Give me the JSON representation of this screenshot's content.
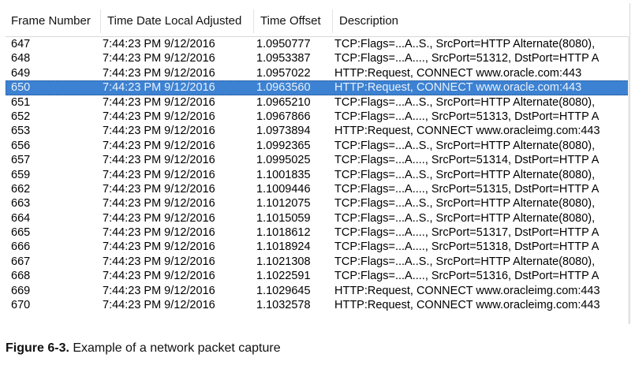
{
  "table": {
    "columns": {
      "frame": "Frame Number",
      "time": "Time Date Local Adjusted",
      "offset": "Time Offset",
      "description": "Description"
    },
    "selected_index": 3,
    "rows": [
      {
        "frame": "647",
        "time": "7:44:23 PM 9/12/2016",
        "offset": "1.0950777",
        "description": "TCP:Flags=...A..S., SrcPort=HTTP Alternate(8080),"
      },
      {
        "frame": "648",
        "time": "7:44:23 PM 9/12/2016",
        "offset": "1.0953387",
        "description": "TCP:Flags=...A...., SrcPort=51312, DstPort=HTTP A"
      },
      {
        "frame": "649",
        "time": "7:44:23 PM 9/12/2016",
        "offset": "1.0957022",
        "description": "HTTP:Request, CONNECT www.oracle.com:443"
      },
      {
        "frame": "650",
        "time": "7:44:23 PM 9/12/2016",
        "offset": "1.0963560",
        "description": "HTTP:Request, CONNECT www.oracle.com:443"
      },
      {
        "frame": "651",
        "time": "7:44:23 PM 9/12/2016",
        "offset": "1.0965210",
        "description": "TCP:Flags=...A..S., SrcPort=HTTP Alternate(8080),"
      },
      {
        "frame": "652",
        "time": "7:44:23 PM 9/12/2016",
        "offset": "1.0967866",
        "description": "TCP:Flags=...A...., SrcPort=51313, DstPort=HTTP A"
      },
      {
        "frame": "653",
        "time": "7:44:23 PM 9/12/2016",
        "offset": "1.0973894",
        "description": "HTTP:Request, CONNECT www.oracleimg.com:443"
      },
      {
        "frame": "656",
        "time": "7:44:23 PM 9/12/2016",
        "offset": "1.0992365",
        "description": "TCP:Flags=...A..S., SrcPort=HTTP Alternate(8080),"
      },
      {
        "frame": "657",
        "time": "7:44:23 PM 9/12/2016",
        "offset": "1.0995025",
        "description": "TCP:Flags=...A...., SrcPort=51314, DstPort=HTTP A"
      },
      {
        "frame": "659",
        "time": "7:44:23 PM 9/12/2016",
        "offset": "1.1001835",
        "description": "TCP:Flags=...A..S., SrcPort=HTTP Alternate(8080),"
      },
      {
        "frame": "662",
        "time": "7:44:23 PM 9/12/2016",
        "offset": "1.1009446",
        "description": "TCP:Flags=...A...., SrcPort=51315, DstPort=HTTP A"
      },
      {
        "frame": "663",
        "time": "7:44:23 PM 9/12/2016",
        "offset": "1.1012075",
        "description": "TCP:Flags=...A..S., SrcPort=HTTP Alternate(8080),"
      },
      {
        "frame": "664",
        "time": "7:44:23 PM 9/12/2016",
        "offset": "1.1015059",
        "description": "TCP:Flags=...A..S., SrcPort=HTTP Alternate(8080),"
      },
      {
        "frame": "665",
        "time": "7:44:23 PM 9/12/2016",
        "offset": "1.1018612",
        "description": "TCP:Flags=...A...., SrcPort=51317, DstPort=HTTP A"
      },
      {
        "frame": "666",
        "time": "7:44:23 PM 9/12/2016",
        "offset": "1.1018924",
        "description": "TCP:Flags=...A...., SrcPort=51318, DstPort=HTTP A"
      },
      {
        "frame": "667",
        "time": "7:44:23 PM 9/12/2016",
        "offset": "1.1021308",
        "description": "TCP:Flags=...A..S., SrcPort=HTTP Alternate(8080),"
      },
      {
        "frame": "668",
        "time": "7:44:23 PM 9/12/2016",
        "offset": "1.1022591",
        "description": "TCP:Flags=...A...., SrcPort=51316, DstPort=HTTP A"
      },
      {
        "frame": "669",
        "time": "7:44:23 PM 9/12/2016",
        "offset": "1.1029645",
        "description": "HTTP:Request, CONNECT www.oracleimg.com:443"
      },
      {
        "frame": "670",
        "time": "7:44:23 PM 9/12/2016",
        "offset": "1.1032578",
        "description": "HTTP:Request, CONNECT www.oracleimg.com:443"
      }
    ]
  },
  "caption": {
    "label": "Figure 6-3.",
    "text": "Example of a network packet capture"
  },
  "colors": {
    "selected_row_bg": "#3d82d2",
    "selected_row_text": "#e8f0fa"
  }
}
